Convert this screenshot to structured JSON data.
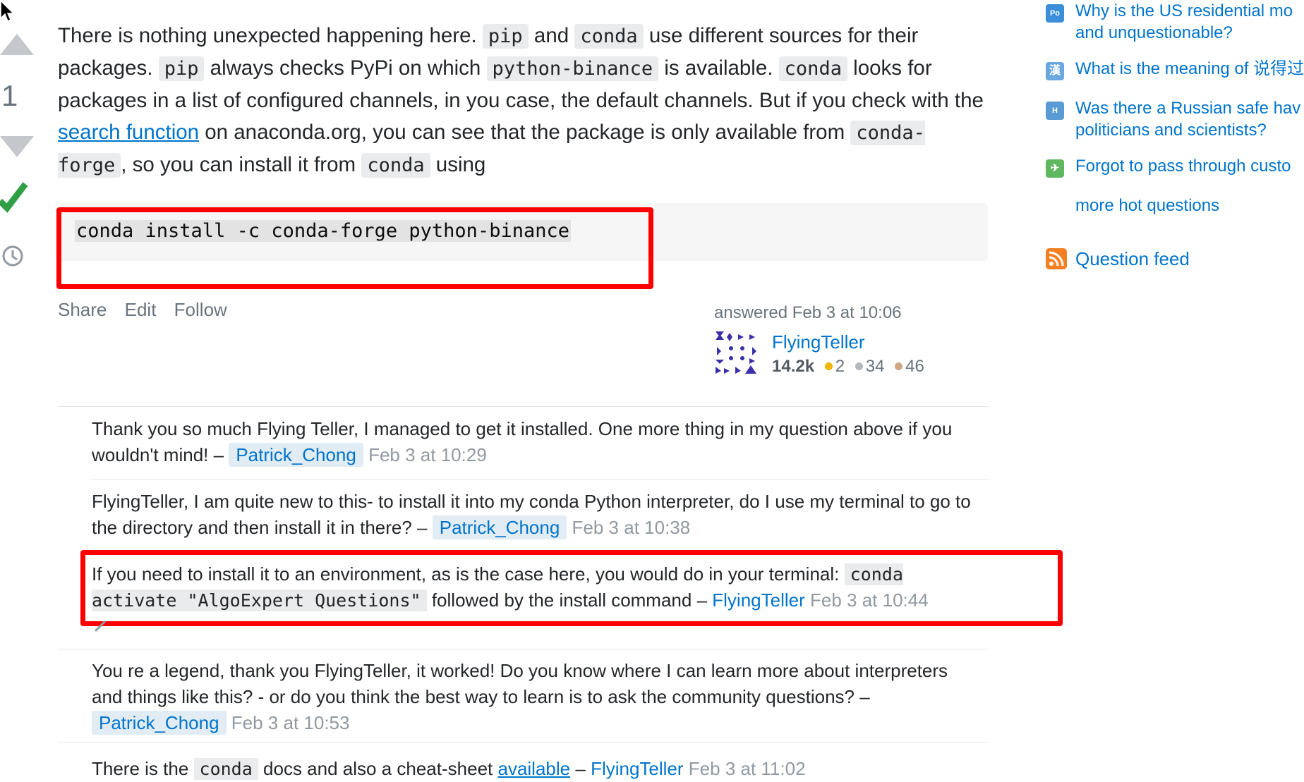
{
  "vote": {
    "count": "1"
  },
  "answer": {
    "p1": "There is nothing unexpected happening here.",
    "pip": "pip",
    "and": "and",
    "conda": "conda",
    "p2": "use different sources for their packages.",
    "p3": "always checks PyPi on which",
    "pkg": "python-binance",
    "p4": "is available.",
    "p5": "looks for packages in a list of configured channels, in you case, the default channels. But if you check with the",
    "link": "search function",
    "p6": "on anaconda.org, you can see that the package is only available from",
    "forge": "conda-forge",
    "p7": ", so you can install it from",
    "p8": "using",
    "code": "conda install -c conda-forge python-binance"
  },
  "menu": {
    "share": "Share",
    "edit": "Edit",
    "follow": "Follow"
  },
  "user": {
    "answered": "answered Feb 3 at 10:06",
    "name": "FlyingTeller",
    "rep": "14.2k",
    "gold": "2",
    "silver": "34",
    "bronze": "46"
  },
  "comments": [
    {
      "text": "Thank you so much Flying Teller, I managed to get it installed. One more thing in my question above if you wouldn't mind! –",
      "author": "Patrick_Chong",
      "date": "Feb 3 at 10:29"
    },
    {
      "text": "FlyingTeller, I am quite new to this- to install it into my conda Python interpreter, do I use my terminal to go to the directory and then install it in there? –",
      "author": "Patrick_Chong",
      "date": "Feb 3 at 10:38"
    },
    {
      "text_a": "If you need to install it to an environment, as is the case here, you would do in your terminal:",
      "code": "conda activate \"AlgoExpert Questions\"",
      "text_b": "followed by the install command –",
      "author": "FlyingTeller",
      "date": "Feb 3 at 10:44"
    },
    {
      "text": "You re a legend, thank you FlyingTeller, it worked! Do you know where I can learn more about interpreters and things like this? - or do you think the best way to learn is to ask the community questions? –",
      "author": "Patrick_Chong",
      "date": "Feb 3 at 10:53"
    },
    {
      "text_a": "There is the",
      "code": "conda",
      "text_b": "docs and also a cheat-sheet",
      "link": "available",
      "dash": "–",
      "author": "FlyingTeller",
      "date": "Feb 3 at 11:02"
    }
  ],
  "sidebar": {
    "hot": [
      {
        "site": "Po",
        "color": "#3b8fd8",
        "line1": "Why is the US residential mo",
        "line2": "and unquestionable?"
      },
      {
        "site": "漢",
        "color": "#6aa7e0",
        "line1": "What is the meaning of 说得过",
        "line2": ""
      },
      {
        "site": "H",
        "color": "#5b9bd5",
        "line1": "Was there a Russian safe hav",
        "line2": "politicians and scientists?"
      },
      {
        "site": "✈",
        "color": "#5fb85f",
        "line1": "Forgot to pass through custo",
        "line2": ""
      }
    ],
    "more": "more hot questions",
    "feed": "Question feed"
  }
}
